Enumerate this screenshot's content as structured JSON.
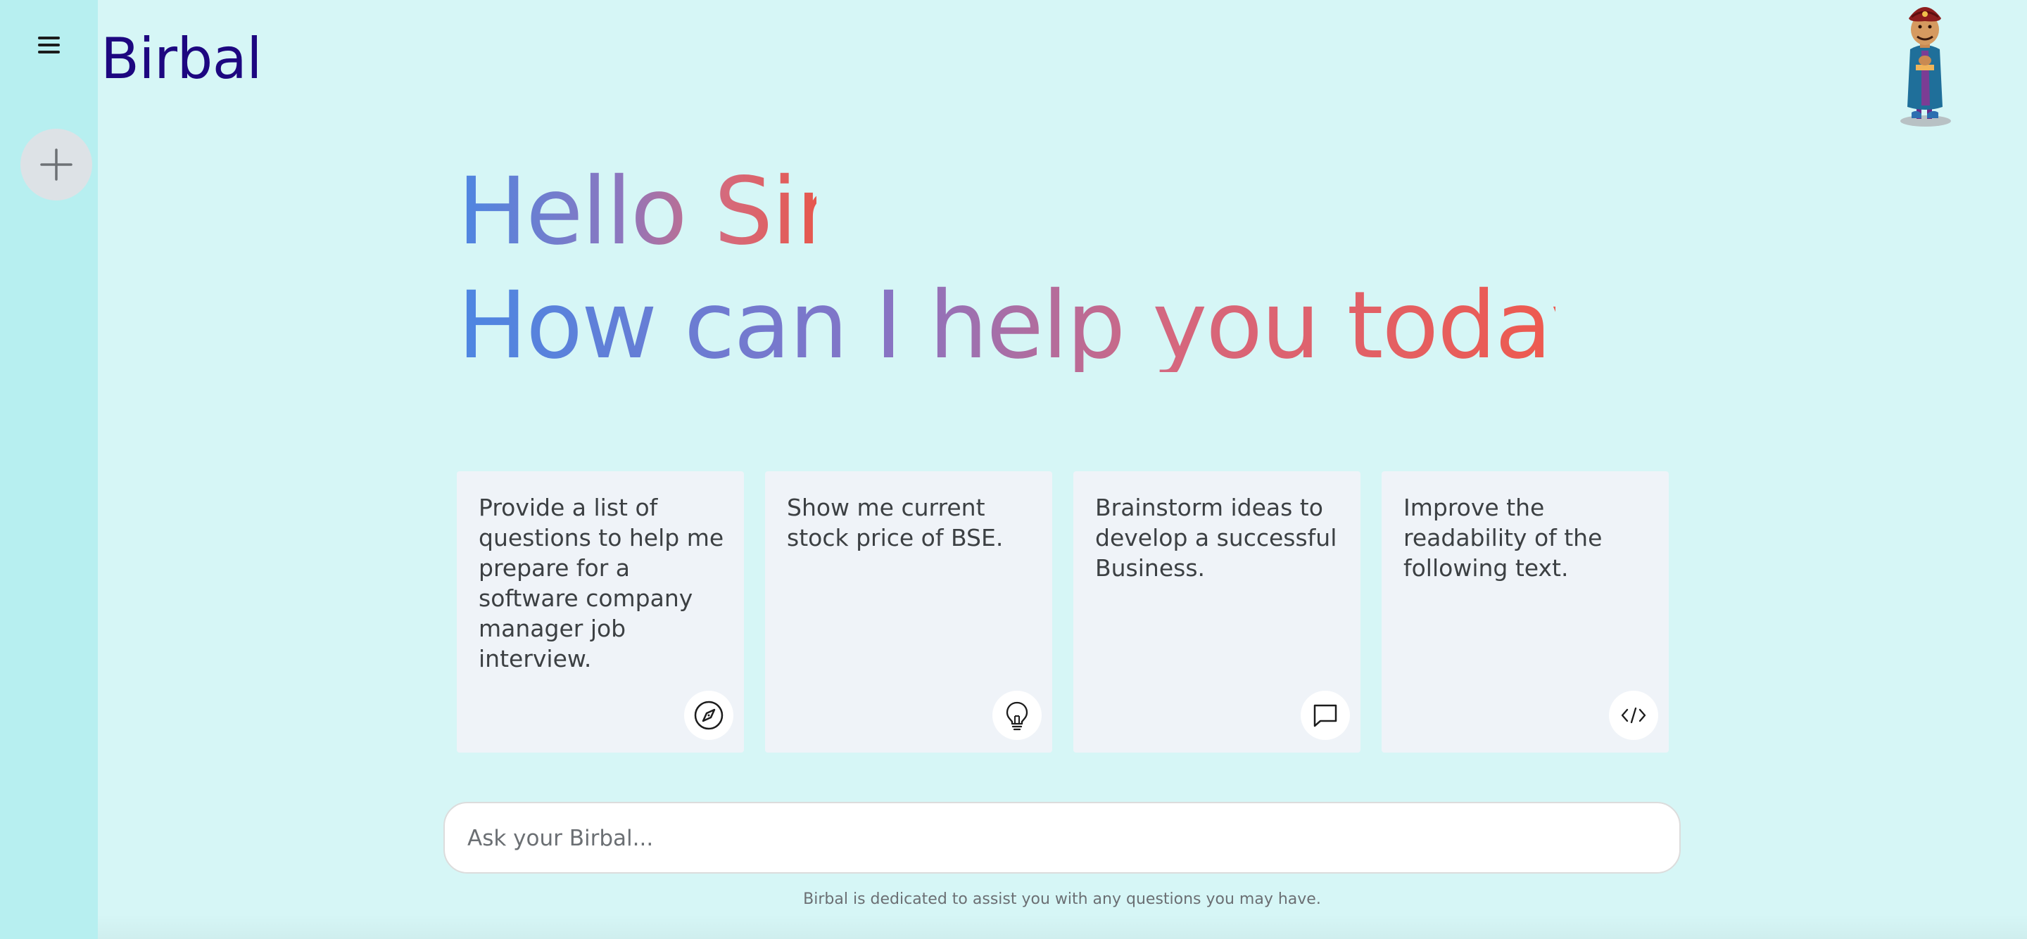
{
  "app": {
    "brand": "Birbal"
  },
  "sidebar": {
    "menu_icon": "hamburger-menu-icon",
    "new_chat_icon": "plus-icon"
  },
  "greeting": {
    "line1": "Hello Sir,",
    "line2": "How can I help you today..?",
    "gradient_colors": [
      "#4d86e2",
      "#8474c6",
      "#d5677e",
      "#ee5a4f"
    ]
  },
  "suggestions": [
    {
      "text": "Provide a list of questions to help me prepare for a software company manager job interview.",
      "icon": "compass-icon"
    },
    {
      "text": "Show me current stock price of BSE.",
      "icon": "lightbulb-icon"
    },
    {
      "text": "Brainstorm ideas to develop a successful Business.",
      "icon": "chat-bubble-icon"
    },
    {
      "text": "Improve the readability of the following text.",
      "icon": "code-icon"
    }
  ],
  "prompt": {
    "placeholder": "Ask your Birbal...",
    "value": ""
  },
  "footer": {
    "note": "Birbal is dedicated to assist you with any questions you may have."
  },
  "colors": {
    "background": "#d6f6f6",
    "sidebar": "#b7eff0",
    "brand": "#1d0780",
    "card": "#eff3f8"
  }
}
